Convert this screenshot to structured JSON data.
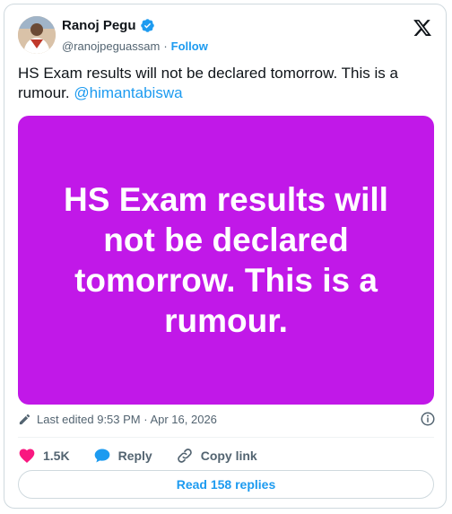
{
  "author": {
    "name": "Ranoj Pegu",
    "handle": "@ranojpeguassam",
    "separator": "·",
    "follow_label": "Follow"
  },
  "tweet": {
    "text": "HS Exam results will not be declared tomorrow. This is a rumour. ",
    "mention": "@himantabiswa"
  },
  "media": {
    "text": "HS Exam results will not be declared tomorrow. This is a rumour.",
    "background_color": "#c118e8"
  },
  "meta": {
    "edited_label": "Last edited 9:53 PM · Apr 16, 2026",
    "edit_icon": "pencil-icon",
    "info_icon": "info-icon"
  },
  "actions": {
    "likes": "1.5K",
    "reply_label": "Reply",
    "copy_label": "Copy link"
  },
  "read_replies_label": "Read 158 replies",
  "colors": {
    "accent": "#1d9bf0",
    "like": "#f91880",
    "text": "#0f1419",
    "secondary": "#536471"
  }
}
